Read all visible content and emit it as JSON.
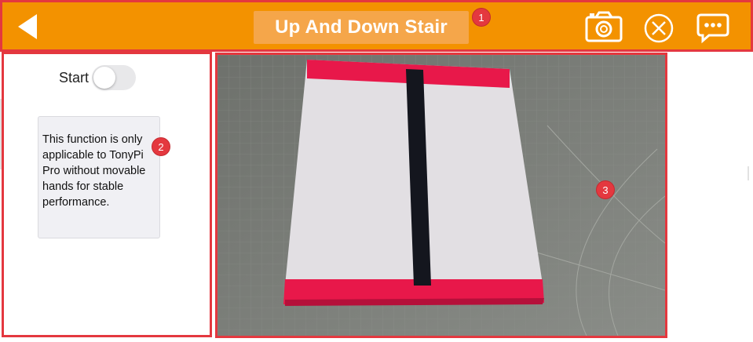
{
  "header": {
    "title": "Up And Down Stair",
    "background_color": "#F39200",
    "badge_label": "1",
    "icons": [
      "back-arrow-icon",
      "camera-icon",
      "close-circle-icon",
      "chat-bubble-icon"
    ]
  },
  "left_panel": {
    "toggle_label": "Start",
    "toggle_on": false,
    "info_text": "This function is only applicable to TonyPi Pro without movable hands for stable performance.",
    "badge_label": "2"
  },
  "camera_view": {
    "badge_label": "3",
    "description_colors": {
      "board": "#E2DFE3",
      "stripe": "#E8184A",
      "center_line": "#14161E",
      "mat": "#787B76"
    }
  },
  "annotation_color": "#E4383F"
}
